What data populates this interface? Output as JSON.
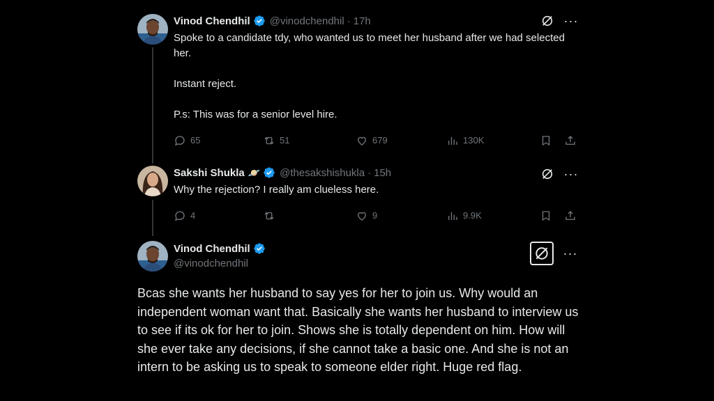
{
  "tweets": [
    {
      "name": "Vinod Chendhil",
      "handle": "@vinodchendhil",
      "dot": "·",
      "time": "17h",
      "text": "Spoke to a candidate tdy, who wanted us to meet her husband after we had selected her.\n\nInstant reject.\n\nP.s: This was for a senior level hire.",
      "replies": "65",
      "retweets": "51",
      "likes": "679",
      "views": "130K"
    },
    {
      "name": "Sakshi Shukla",
      "emoji": "🪐",
      "handle": "@thesakshishukla",
      "dot": "·",
      "time": "15h",
      "text": "Why the rejection? I really am clueless here.",
      "replies": "4",
      "retweets": "",
      "likes": "9",
      "views": "9.9K"
    }
  ],
  "main_tweet": {
    "name": "Vinod Chendhil",
    "handle": "@vinodchendhil",
    "text": "Bcas she wants her husband to say yes for her to join us. Why would an independent woman want that. Basically she wants her husband to interview us to see if its ok for her to join. Shows she is totally dependent on him. How will she ever take any decisions, if she cannot take a basic one. And she is not an intern to be asking us to speak to someone elder right. Huge red flag."
  },
  "icons": {
    "more": "···",
    "verified_color": "#1d9bf0"
  }
}
